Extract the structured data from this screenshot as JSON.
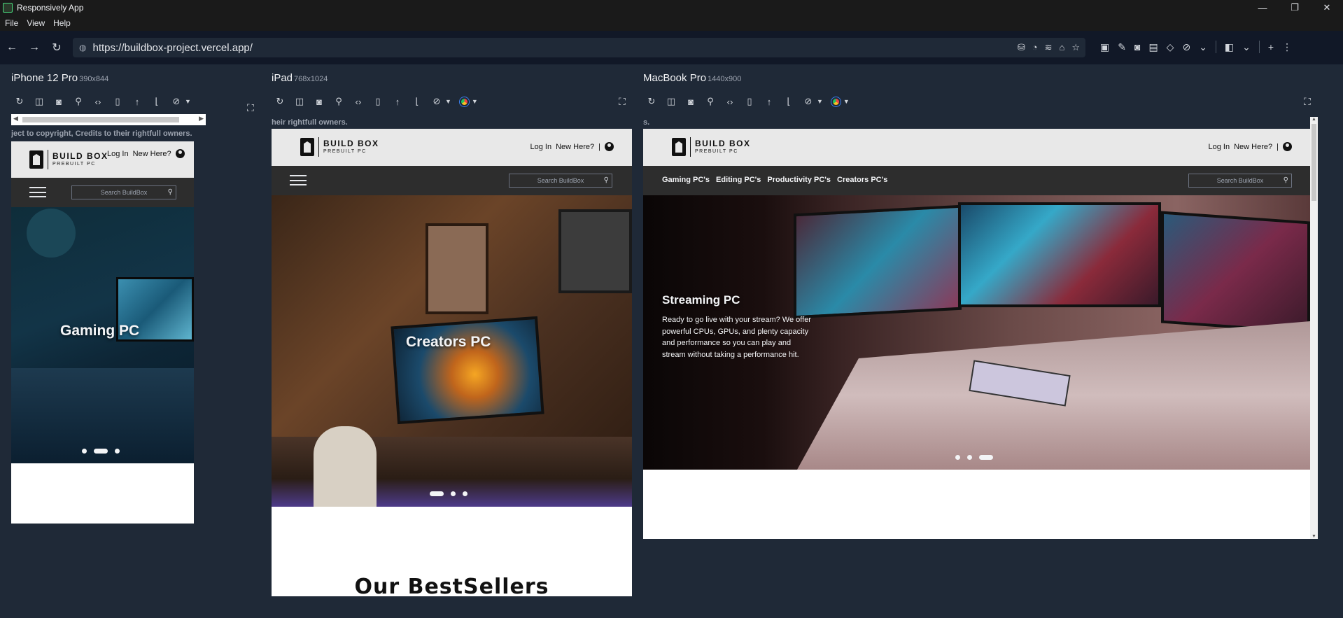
{
  "app": {
    "title": "Responsively App",
    "icon": "responsively-app-icon"
  },
  "window_controls": {
    "minimize": "—",
    "restore": "❐",
    "close": "✕"
  },
  "menu": [
    "File",
    "View",
    "Help"
  ],
  "toolbar": {
    "url": "https://buildbox-project.vercel.app/",
    "back": "←",
    "forward": "→",
    "reload": "↻"
  },
  "site": {
    "notice_iphone": "ject to copyright, Credits to their rightfull owners.",
    "notice_ipad": "heir rightfull owners.",
    "notice_mac": "s.",
    "logo_line1": "BUILD BOX",
    "logo_line2": "PREBUILT PC",
    "login": "Log In",
    "signup": "New Here?",
    "search_placeholder": "Search BuildBox",
    "nav_links": [
      "Gaming PC's",
      "Editing PC's",
      "Productivity PC's",
      "Creators PC's"
    ],
    "bestsellers_heading": "Our BestSellers"
  },
  "devices": {
    "iphone": {
      "name": "iPhone 12 Pro",
      "size": "390x844",
      "hero_title": "Gaming PC"
    },
    "ipad": {
      "name": "iPad",
      "size": "768x1024",
      "hero_title": "Creators PC"
    },
    "mac": {
      "name": "MacBook Pro",
      "size": "1440x900",
      "hero_title": "Streaming PC",
      "hero_text": "Ready to go live with your stream? We offer powerful CPUs, GPUs, and plenty capacity and performance so you can play and stream without taking a performance hit."
    }
  },
  "colors": {
    "app_bg": "#1f2937",
    "site_header_bg": "#e8e8e8",
    "site_nav_bg": "#2d2d2d"
  }
}
